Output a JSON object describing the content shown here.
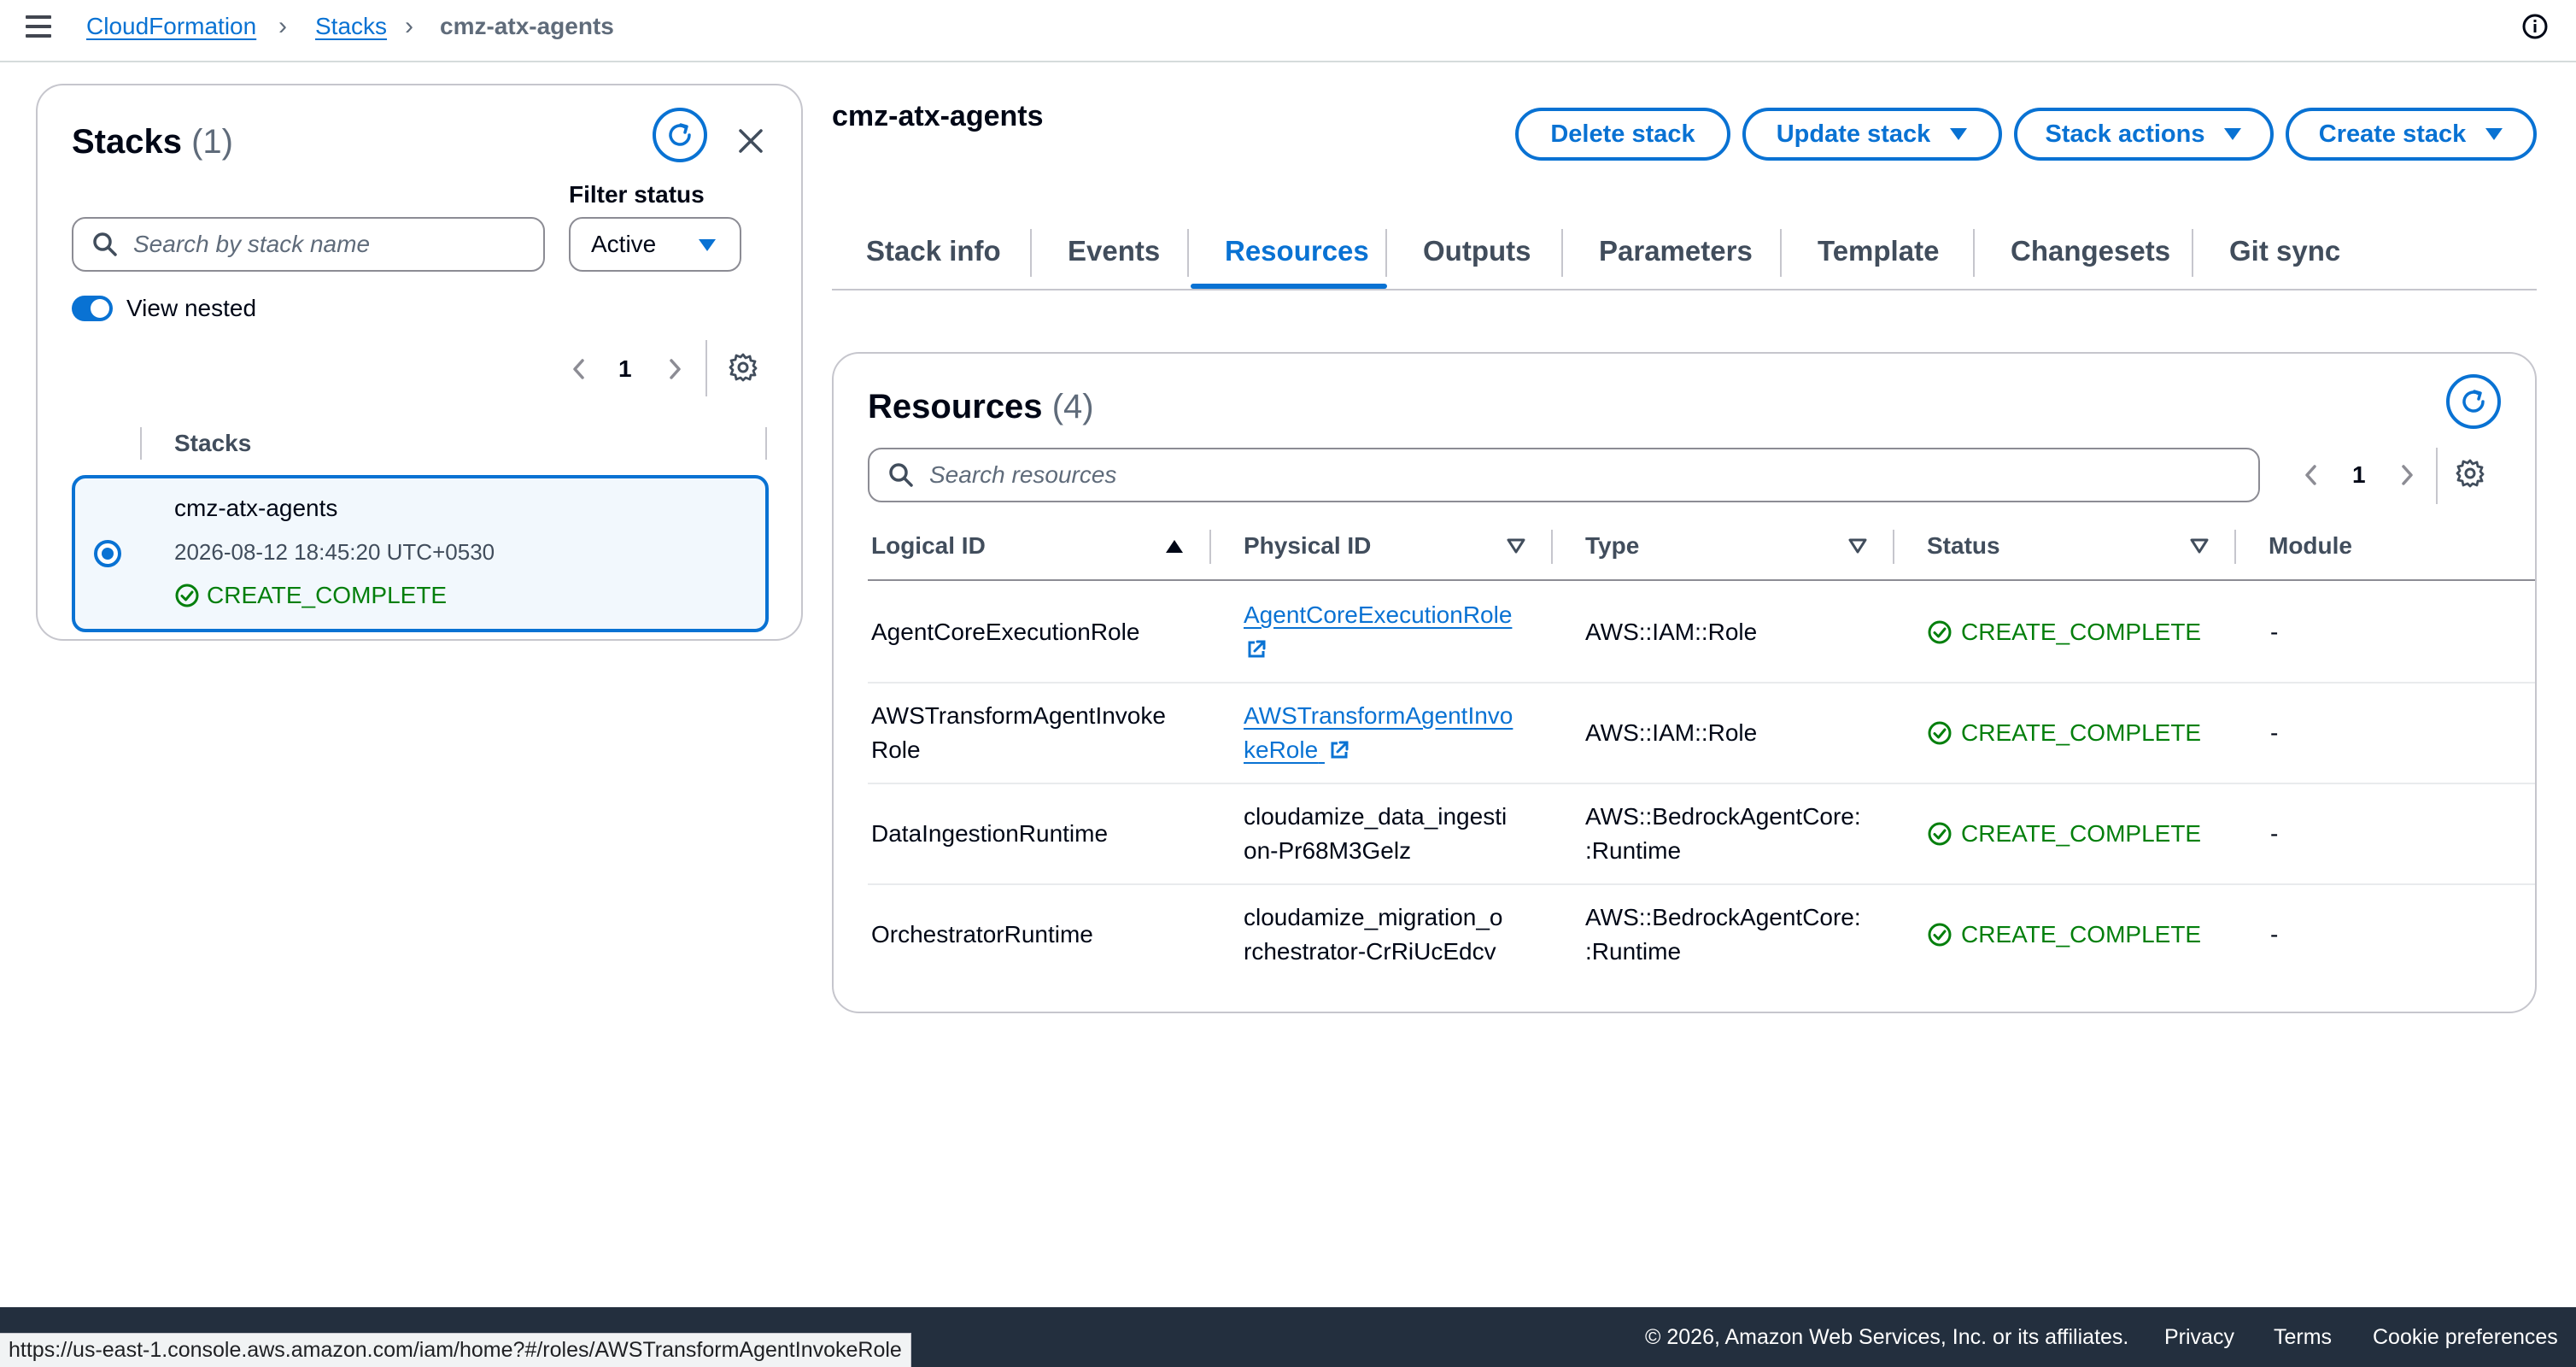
{
  "breadcrumb": {
    "root": "CloudFormation",
    "stacks": "Stacks",
    "current": "cmz-atx-agents"
  },
  "left_panel": {
    "title": "Stacks",
    "count": "(1)",
    "search_placeholder": "Search by stack name",
    "filter_label": "Filter status",
    "filter_value": "Active",
    "view_nested_label": "View nested",
    "view_nested_on": true,
    "page": "1",
    "column_header": "Stacks",
    "stacks": [
      {
        "name": "cmz-atx-agents",
        "created": "2026-08-12 18:45:20 UTC+0530",
        "status": "CREATE_COMPLETE",
        "selected": true
      }
    ]
  },
  "main": {
    "stack_title": "cmz-atx-agents",
    "buttons": {
      "delete": "Delete stack",
      "update": "Update stack",
      "actions": "Stack actions",
      "create": "Create stack"
    },
    "tabs": [
      {
        "label": "Stack info"
      },
      {
        "label": "Events"
      },
      {
        "label": "Resources",
        "active": true
      },
      {
        "label": "Outputs"
      },
      {
        "label": "Parameters"
      },
      {
        "label": "Template"
      },
      {
        "label": "Changesets"
      },
      {
        "label": "Git sync"
      }
    ],
    "resources": {
      "title": "Resources",
      "count": "(4)",
      "search_placeholder": "Search resources",
      "page": "1",
      "columns": [
        "Logical ID",
        "Physical ID",
        "Type",
        "Status",
        "Module"
      ],
      "rows": [
        {
          "logical_id": [
            "AgentCoreExecutionRole"
          ],
          "physical_id": [
            "AgentCoreExecutionRole",
            ""
          ],
          "physical_is_link": true,
          "type": [
            "AWS::IAM::Role"
          ],
          "status": "CREATE_COMPLETE",
          "module": "-"
        },
        {
          "logical_id": [
            "AWSTransformAgentInvoke",
            "Role"
          ],
          "physical_id": [
            "AWSTransformAgentInvo",
            "keRole"
          ],
          "physical_is_link": true,
          "type": [
            "AWS::IAM::Role"
          ],
          "status": "CREATE_COMPLETE",
          "module": "-"
        },
        {
          "logical_id": [
            "DataIngestionRuntime"
          ],
          "physical_id": [
            "cloudamize_data_ingesti",
            "on-Pr68M3Gelz"
          ],
          "physical_is_link": false,
          "type": [
            "AWS::BedrockAgentCore:",
            ":Runtime"
          ],
          "status": "CREATE_COMPLETE",
          "module": "-"
        },
        {
          "logical_id": [
            "OrchestratorRuntime"
          ],
          "physical_id": [
            "cloudamize_migration_o",
            "rchestrator-CrRiUcEdcv"
          ],
          "physical_is_link": false,
          "type": [
            "AWS::BedrockAgentCore:",
            ":Runtime"
          ],
          "status": "CREATE_COMPLETE",
          "module": "-"
        }
      ]
    }
  },
  "footer": {
    "copyright": "© 2026, Amazon Web Services, Inc. or its affiliates.",
    "privacy": "Privacy",
    "terms": "Terms",
    "cookies": "Cookie preferences"
  },
  "status_url": "https://us-east-1.console.aws.amazon.com/iam/home?#/roles/AWSTransformAgentInvokeRole",
  "colors": {
    "accent": "#0972d3",
    "success": "#037f0c",
    "footer_bg": "#232f3e"
  }
}
